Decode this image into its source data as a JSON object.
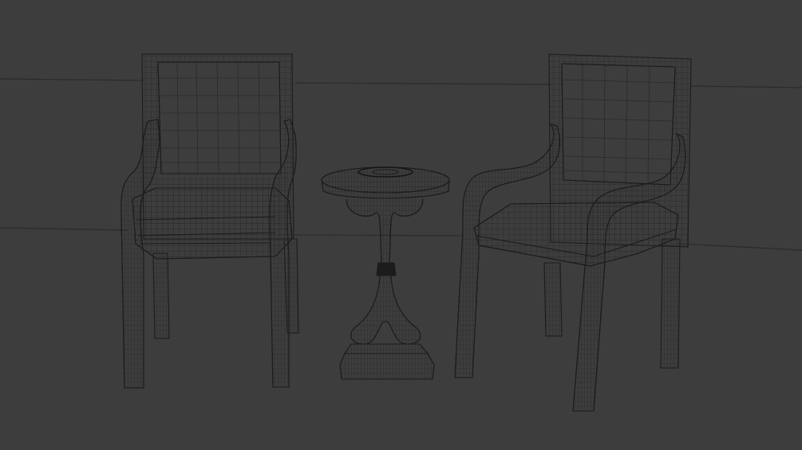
{
  "scene": {
    "background_color": "#3d3d3d",
    "wire_color": "#1c1c1c",
    "wire_minor_color": "#2a2a2a",
    "horizon_color": "#2b2b2b",
    "objects": [
      {
        "name": "left-armchair",
        "kind": "wireframe-armchair"
      },
      {
        "name": "round-side-table",
        "kind": "wireframe-pedestal-table"
      },
      {
        "name": "right-armchair",
        "kind": "wireframe-armchair"
      }
    ]
  }
}
